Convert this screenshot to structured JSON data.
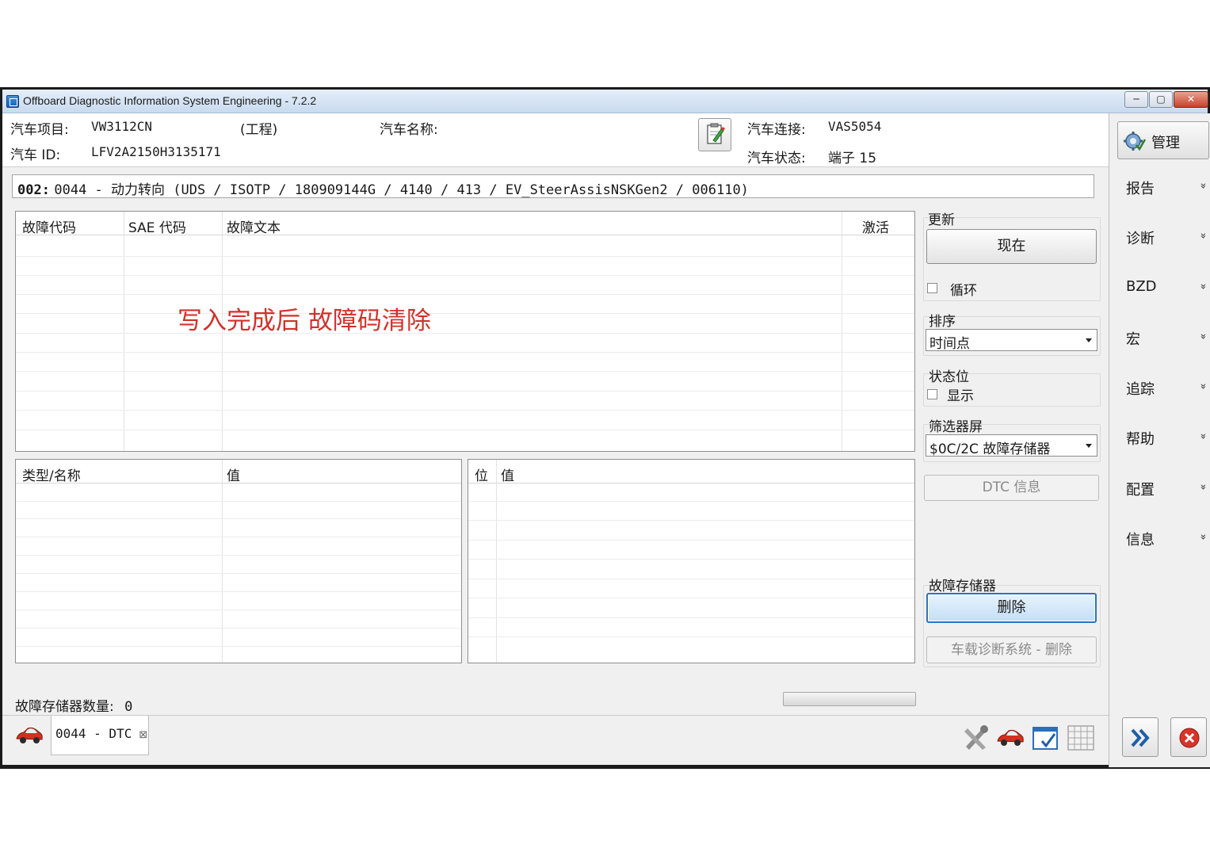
{
  "window": {
    "title": "Offboard Diagnostic Information System Engineering - 7.2.2",
    "controls": {
      "minimize": "─",
      "maximize": "▢",
      "close": "✕"
    }
  },
  "header": {
    "project_label": "汽车项目:",
    "project_value": "VW3112CN",
    "project_note": "(工程)",
    "vehicle_name_label": "汽车名称:",
    "vehicle_name_value": "",
    "vehicle_id_label": "汽车 ID:",
    "vehicle_id_value": "LFV2A2150H3135171",
    "connection_label": "汽车连接:",
    "connection_value": "VAS5054",
    "status_label": "汽车状态:",
    "status_value": "端子 15",
    "note_icon": "edit-note-icon"
  },
  "ecu": {
    "address": "002:",
    "description": "0044 - 动力转向  (UDS / ISOTP / 180909144G / 4140 / 413 / EV_SteerAssisNSKGen2 / 006110)"
  },
  "dtc_table": {
    "columns": [
      "故障代码",
      "SAE 代码",
      "故障文本",
      "激活"
    ],
    "rows": []
  },
  "annotation": "写入完成后 故障码清除",
  "freeze_table": {
    "columns": [
      "类型/名称",
      "值"
    ],
    "rows": []
  },
  "bits_table": {
    "columns": [
      "位",
      "值"
    ],
    "rows": []
  },
  "controls": {
    "update_label": "更新",
    "now_button": "现在",
    "loop_label": "循环",
    "loop_checked": false,
    "sort_label": "排序",
    "sort_value": "时间点",
    "status_bits_label": "状态位",
    "show_label": "显示",
    "show_checked": false,
    "filter_label": "筛选器屏",
    "filter_value": "$0C/2C 故障存储器",
    "dtc_info_button": "DTC 信息",
    "fault_memory_label": "故障存储器",
    "delete_button": "删除",
    "obd_delete_button": "车载诊断系统 - 删除"
  },
  "status": {
    "count_label": "故障存储器数量:",
    "count_value": "0",
    "progress": 0
  },
  "bottom": {
    "tab_label": "0044 - DTC",
    "tab_close": "⊠",
    "toolbar_icons": [
      "tools-icon",
      "car-icon",
      "checklist-icon",
      "grid-icon"
    ]
  },
  "sidebar": {
    "manage_button": "管理",
    "items": [
      {
        "label": "报告",
        "chevron": "»"
      },
      {
        "label": "诊断",
        "chevron": "»"
      },
      {
        "label": "BZD",
        "chevron": "»"
      },
      {
        "label": "宏",
        "chevron": "»"
      },
      {
        "label": "追踪",
        "chevron": "»"
      },
      {
        "label": "帮助",
        "chevron": "»"
      },
      {
        "label": "配置",
        "chevron": "»"
      },
      {
        "label": "信息",
        "chevron": "»"
      }
    ]
  },
  "colors": {
    "annotation": "#d2312a",
    "titlebar": "#c9dbef",
    "close_button": "#c8412b",
    "focus_border": "#2a73c4"
  }
}
